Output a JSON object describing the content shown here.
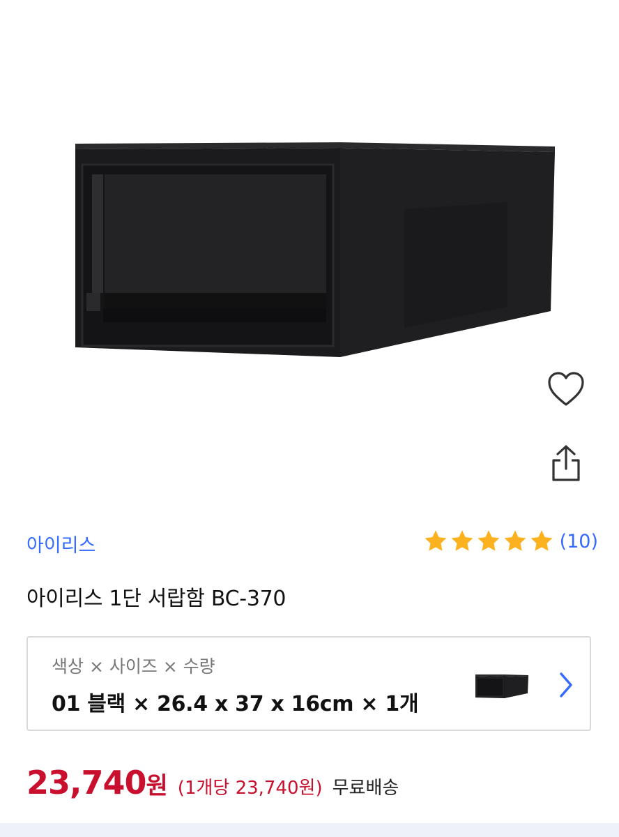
{
  "product": {
    "brand": "아이리스",
    "title": "아이리스 1단 서랍함 BC-370",
    "rating_stars": 5,
    "review_count": "(10)",
    "image_icon": "black-storage-drawer"
  },
  "actions": {
    "wishlist_icon": "heart-outline-icon",
    "share_icon": "share-icon"
  },
  "option": {
    "label": "색상 × 사이즈 × 수량",
    "value": "01 블랙 × 26.4  x 37 x 16cm × 1개",
    "chevron_icon": "chevron-right-icon"
  },
  "price": {
    "amount": "23,740",
    "currency": "원",
    "unit_price": "(1개당 23,740원)",
    "shipping": "무료배송"
  },
  "colors": {
    "accent": "#346aff",
    "price": "#c8102e",
    "star": "#fbb21e"
  }
}
